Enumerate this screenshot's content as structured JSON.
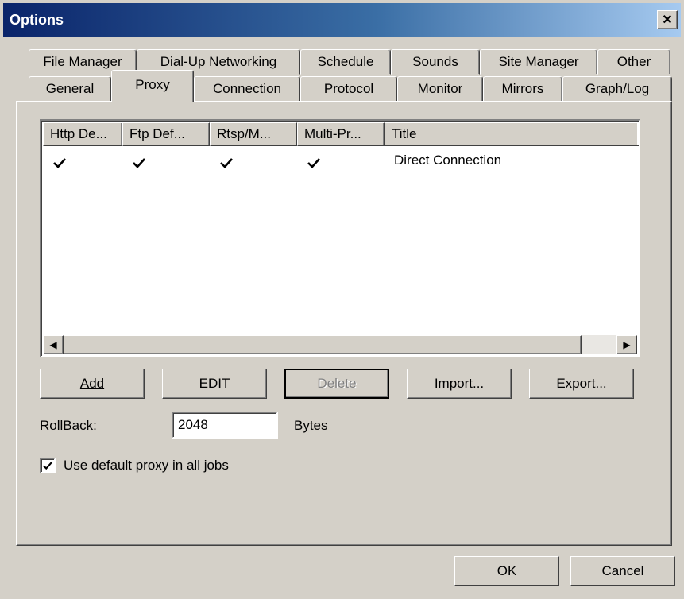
{
  "window": {
    "title": "Options"
  },
  "tabs_row1": [
    {
      "label": "File Manager"
    },
    {
      "label": "Dial-Up Networking"
    },
    {
      "label": "Schedule"
    },
    {
      "label": "Sounds"
    },
    {
      "label": "Site Manager"
    },
    {
      "label": "Other"
    }
  ],
  "tabs_row2": [
    {
      "label": "General"
    },
    {
      "label": "Proxy"
    },
    {
      "label": "Connection"
    },
    {
      "label": "Protocol"
    },
    {
      "label": "Monitor"
    },
    {
      "label": "Mirrors"
    },
    {
      "label": "Graph/Log"
    }
  ],
  "active_tab": "Proxy",
  "list": {
    "columns": [
      "Http De...",
      "Ftp Def...",
      "Rtsp/M...",
      "Multi-Pr...",
      "Title"
    ],
    "rows": [
      {
        "http_default": true,
        "ftp_default": true,
        "rtsp_default": true,
        "multi_default": true,
        "title": "Direct Connection"
      }
    ]
  },
  "buttons": {
    "add": {
      "label": "Add",
      "mnemonic": "A"
    },
    "edit": {
      "label": "EDIT",
      "mnemonic": "E"
    },
    "delete": {
      "label": "Delete",
      "mnemonic": "D",
      "disabled": true
    },
    "import": {
      "label": "Import...",
      "mnemonic": "I"
    },
    "export": {
      "label": "Export...",
      "mnemonic": "o"
    }
  },
  "rollback": {
    "label": "RollBack:",
    "value": "2048",
    "unit": "Bytes"
  },
  "default_proxy": {
    "label": "Use default proxy in all jobs",
    "checked": true
  },
  "dialog_buttons": {
    "ok": "OK",
    "cancel": "Cancel"
  }
}
